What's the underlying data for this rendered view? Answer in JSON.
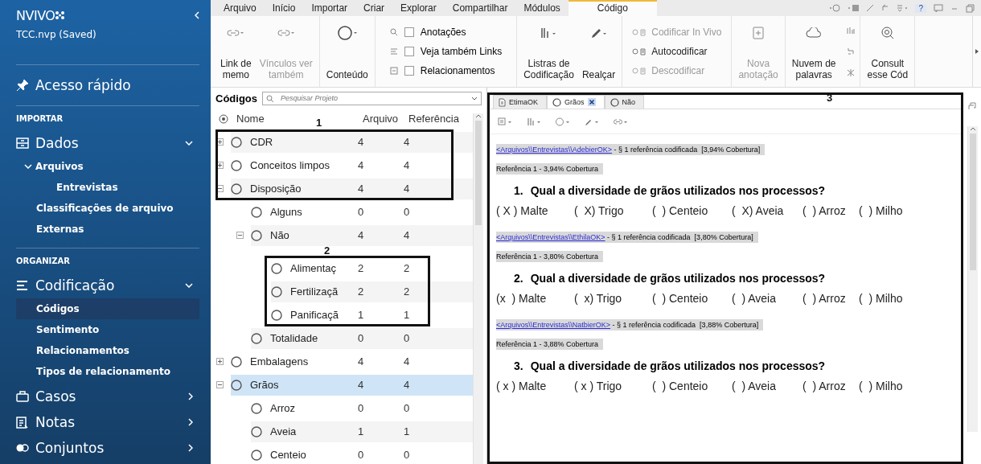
{
  "sidebar": {
    "logo": "NVIVO",
    "project": "TCC.nvp (Saved)",
    "quick_access": "Acesso rápido",
    "sections": [
      {
        "heading": "IMPORTAR",
        "groups": [
          {
            "kind": "data",
            "label": "Dados",
            "expanded": true,
            "items": [
              {
                "label": "Arquivos",
                "expanded": true,
                "selected": false,
                "children": [
                  {
                    "label": "Entrevistas",
                    "selected": false
                  }
                ]
              },
              {
                "label": "Classificações de arquivo",
                "selected": false
              },
              {
                "label": "Externas",
                "selected": false
              }
            ]
          }
        ]
      },
      {
        "heading": "ORGANIZAR",
        "groups": [
          {
            "kind": "coding",
            "label": "Codificação",
            "expanded": true,
            "items": [
              {
                "label": "Códigos",
                "selected": true
              },
              {
                "label": "Sentimento",
                "selected": false
              },
              {
                "label": "Relacionamentos",
                "selected": false
              },
              {
                "label": "Tipos de relacionamento",
                "selected": false
              }
            ]
          },
          {
            "kind": "cases",
            "label": "Casos",
            "expanded": false
          },
          {
            "kind": "notes",
            "label": "Notas",
            "expanded": false
          },
          {
            "kind": "sets",
            "label": "Conjuntos",
            "expanded": false
          }
        ]
      }
    ]
  },
  "ribbon": {
    "tabs": [
      {
        "label": "Arquivo",
        "selected": false
      },
      {
        "label": "Início",
        "selected": false
      },
      {
        "label": "Importar",
        "selected": false
      },
      {
        "label": "Criar",
        "selected": false
      },
      {
        "label": "Explorar",
        "selected": false
      },
      {
        "label": "Compartilhar",
        "selected": false
      },
      {
        "label": "Módulos",
        "selected": false
      },
      {
        "label": "Código",
        "selected": true
      }
    ],
    "help": "?",
    "groups": [
      {
        "kind": "buttons",
        "buttons": [
          {
            "kind": "link",
            "label": "Link de\nmemo",
            "disabled": false
          },
          {
            "kind": "link",
            "label": "Vínculos ver\ntambém",
            "disabled": true
          }
        ]
      },
      {
        "kind": "buttons",
        "buttons": [
          {
            "kind": "content",
            "label": "Conteúdo",
            "disabled": false
          }
        ]
      },
      {
        "kind": "checklist",
        "items": [
          {
            "label": "Anotações",
            "checked": false
          },
          {
            "label": "Veja também Links",
            "checked": false
          },
          {
            "label": "Relacionamentos",
            "checked": false
          }
        ]
      },
      {
        "kind": "buttons",
        "buttons": [
          {
            "kind": "stripes",
            "label": "Listras de\nCodificação",
            "disabled": false
          },
          {
            "kind": "highlight",
            "label": "Realçar",
            "disabled": false
          }
        ]
      },
      {
        "kind": "commands",
        "items": [
          {
            "label": "Codificar In Vivo",
            "disabled": true
          },
          {
            "label": "Autocodificar",
            "disabled": false
          },
          {
            "label": "Descodificar",
            "disabled": true
          }
        ]
      },
      {
        "kind": "buttons",
        "buttons": [
          {
            "kind": "annotation",
            "label": "Nova\nanotação",
            "disabled": true
          }
        ]
      },
      {
        "kind": "tools",
        "buttons": [
          {
            "kind": "cloud",
            "label": "Nuvem de\npalavras",
            "disabled": false
          }
        ]
      },
      {
        "kind": "buttons",
        "buttons": [
          {
            "kind": "query",
            "label": "Consult\nesse Cód",
            "disabled": false
          }
        ]
      }
    ]
  },
  "codes": {
    "title": "Códigos",
    "search": {
      "placeholder": "Pesquisar Projeto"
    },
    "columns": [
      "Nome",
      "Arquivo",
      "Referência"
    ],
    "rows": [
      {
        "name": "CDR",
        "files": "4",
        "refs": "4",
        "selected": false,
        "expanded": false
      },
      {
        "name": "Conceitos limpos",
        "files": "4",
        "refs": "4",
        "selected": false,
        "expanded": false
      },
      {
        "name": "Disposição",
        "files": "4",
        "refs": "4",
        "selected": false,
        "expanded": true,
        "children": [
          {
            "name": "Alguns",
            "files": "0",
            "refs": "0",
            "selected": false
          },
          {
            "name": "Não",
            "files": "4",
            "refs": "4",
            "selected": false,
            "expanded": true,
            "children": [
              {
                "name": "Alimentaç",
                "files": "2",
                "refs": "2",
                "selected": false
              },
              {
                "name": "Fertilizaçã",
                "files": "2",
                "refs": "2",
                "selected": false
              },
              {
                "name": "Panificaçã",
                "files": "1",
                "refs": "1",
                "selected": false
              }
            ]
          },
          {
            "name": "Totalidade",
            "files": "0",
            "refs": "0",
            "selected": false
          }
        ]
      },
      {
        "name": "Embalagens",
        "files": "4",
        "refs": "4",
        "selected": false,
        "expanded": false
      },
      {
        "name": "Grãos",
        "files": "4",
        "refs": "4",
        "selected": true,
        "expanded": true,
        "children": [
          {
            "name": "Arroz",
            "files": "0",
            "refs": "0",
            "selected": false
          },
          {
            "name": "Aveia",
            "files": "1",
            "refs": "1",
            "selected": false
          },
          {
            "name": "Centeio",
            "files": "0",
            "refs": "0",
            "selected": false
          }
        ]
      }
    ]
  },
  "detail": {
    "tabs": [
      {
        "kind": "document",
        "label": "EtimaOK",
        "selected": false,
        "closable": false
      },
      {
        "kind": "code",
        "label": "Grãos",
        "selected": true,
        "closable": true
      },
      {
        "kind": "code",
        "label": "Não",
        "selected": false,
        "closable": false
      }
    ],
    "entries": [
      {
        "source": "<Arquivos\\\\Entrevistas\\\\AdebierOK>",
        "summary": " - § 1 referência codificada  [3,94% Cobertura]",
        "reference": "Referência 1 - 3,94% Cobertura",
        "number": "1.",
        "question": "Qual a diversidade de grãos utilizados nos processos?",
        "options": [
          "( X ) Malte",
          "(  X) Trigo",
          "(  ) Centeio",
          "(  X) Aveia",
          "(  ) Arroz",
          "(  ) Milho"
        ]
      },
      {
        "source": "<Arquivos\\\\Entrevistas\\\\EthilaOK>",
        "summary": " - § 1 referência codificada  [3,80% Cobertura]",
        "reference": "Referência 1 - 3,80% Cobertura",
        "number": "2.",
        "question": "Qual a diversidade de grãos utilizados nos processos?",
        "options": [
          "(x  ) Malte",
          "(  x) Trigo",
          "(  ) Centeio",
          "(  ) Aveia",
          "(  ) Arroz",
          "(  ) Milho"
        ]
      },
      {
        "source": "<Arquivos\\\\Entrevistas\\\\NatbierOK>",
        "summary": " - § 1 referência codificada  [3,88% Cobertura]",
        "reference": "Referência 1 - 3,88% Cobertura",
        "number": "3.",
        "question": "Qual a diversidade de grãos utilizados nos processos?",
        "options": [
          "( x ) Malte",
          "( x ) Trigo",
          "(  ) Centeio",
          "(  ) Aveia",
          "(  ) Arroz",
          "(  ) Milho"
        ]
      }
    ]
  },
  "annotations": [
    {
      "label": "1"
    },
    {
      "label": "2"
    },
    {
      "label": "3"
    }
  ]
}
